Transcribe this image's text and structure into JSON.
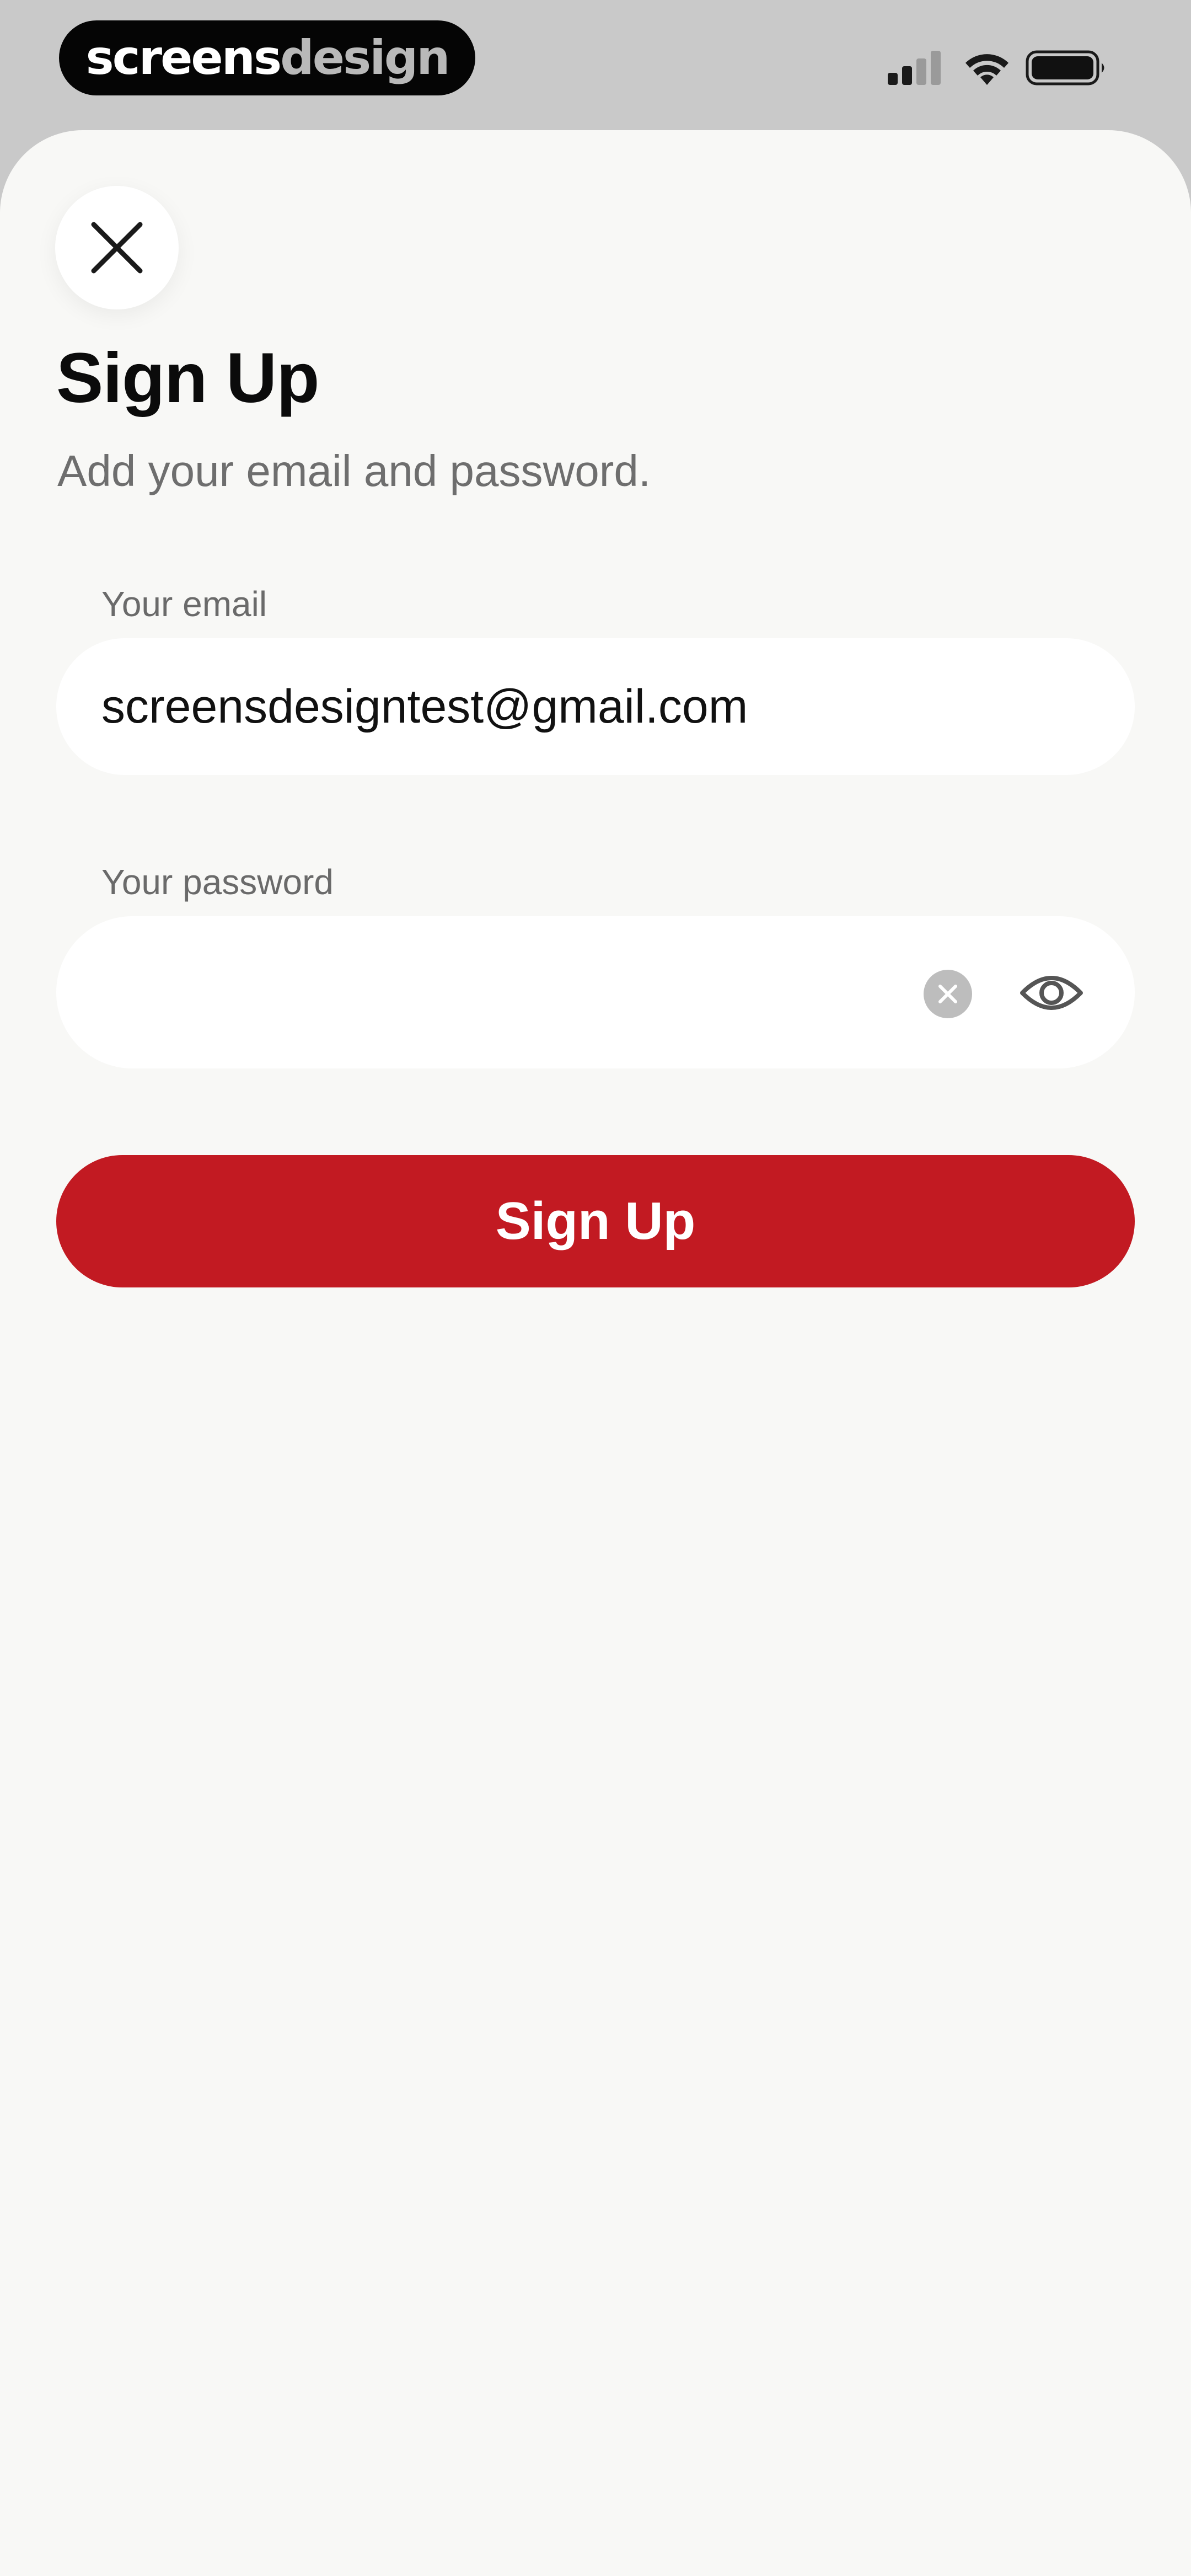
{
  "status_bar": {
    "brand_part1": "screens",
    "brand_part2": "design",
    "signal_icon": "cellular-signal-icon",
    "wifi_icon": "wifi-icon",
    "battery_icon": "battery-icon"
  },
  "sheet": {
    "close_icon": "close-icon",
    "title": "Sign Up",
    "subtitle": "Add your email and password.",
    "email": {
      "label": "Your email",
      "value": "screensdesigntest@gmail.com"
    },
    "password": {
      "label": "Your password",
      "value": "",
      "clear_icon": "clear-icon",
      "visibility_icon": "eye-icon"
    },
    "signup_button": "Sign Up"
  },
  "colors": {
    "accent": "#c21a22",
    "sheet_background": "#f8f8f6",
    "status_background": "#c9c9c9"
  }
}
